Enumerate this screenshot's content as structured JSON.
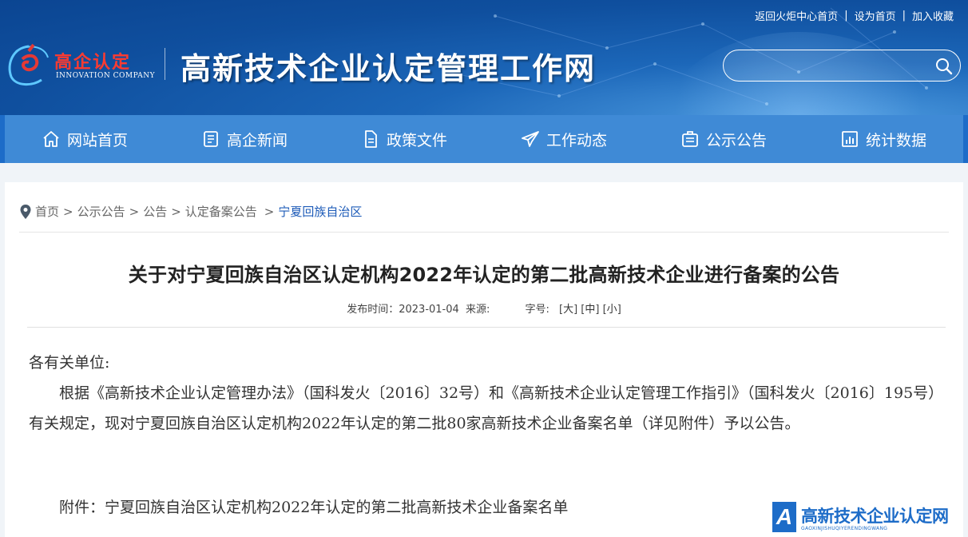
{
  "header": {
    "top_links": [
      "返回火炬中心首页",
      "设为首页",
      "加入收藏"
    ],
    "logo_cn": "高企认定",
    "logo_en": "INNOVATION COMPANY",
    "site_title": "高新技术企业认定管理工作网",
    "search_placeholder": ""
  },
  "nav": {
    "items": [
      {
        "label": "网站首页",
        "icon": "home-icon"
      },
      {
        "label": "高企新闻",
        "icon": "news-icon"
      },
      {
        "label": "政策文件",
        "icon": "document-icon"
      },
      {
        "label": "工作动态",
        "icon": "paper-plane-icon"
      },
      {
        "label": "公示公告",
        "icon": "notice-icon"
      },
      {
        "label": "统计数据",
        "icon": "chart-icon"
      }
    ]
  },
  "breadcrumb": [
    "首页",
    "公示公告",
    "公告",
    "认定备案公告",
    "宁夏回族自治区"
  ],
  "article": {
    "title": "关于对宁夏回族自治区认定机构2022年认定的第二批高新技术企业进行备案的公告",
    "publish_label": "发布时间：",
    "publish_date": "2023-01-04",
    "source_label": "来源:",
    "font_size_label": "字号:",
    "font_sizes": [
      "大",
      "中",
      "小"
    ],
    "salutation": "各有关单位:",
    "paragraph": "根据《高新技术企业认定管理办法》（国科发火〔2016〕32号）和《高新技术企业认定管理工作指引》（国科发火〔2016〕195号）有关规定，现对宁夏回族自治区认定机构2022年认定的第二批80家高新技术企业备案名单（详见附件）予以公告。",
    "attachment": "附件：宁夏回族自治区认定机构2022年认定的第二批高新技术企业备案名单"
  },
  "watermark": {
    "title": "高新技术企业认定网",
    "subtitle": "GAOXINJISHUQIYERENDINGWANG",
    "letter": "A"
  },
  "colors": {
    "header_bg": "#0f4f9e",
    "nav_bg": "#3f8ad6",
    "link_current": "#1d5bb8",
    "logo_red": "#ff3b30"
  }
}
